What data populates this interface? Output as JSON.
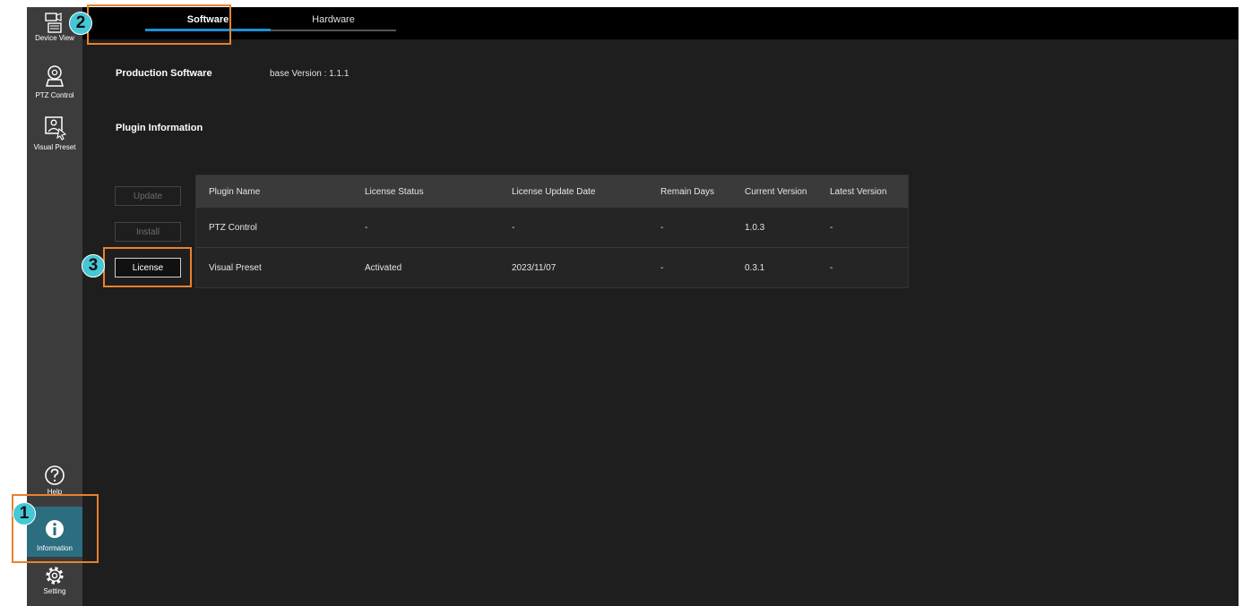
{
  "sidebar": {
    "top_items": [
      {
        "label": "Device View",
        "icon": "device-view-icon"
      },
      {
        "label": "PTZ Control",
        "icon": "ptz-camera-icon"
      },
      {
        "label": "Visual Preset",
        "icon": "visual-preset-icon"
      }
    ],
    "bottom_items": [
      {
        "label": "Help",
        "icon": "help-icon"
      },
      {
        "label": "Information",
        "icon": "info-icon",
        "active": true
      },
      {
        "label": "Setting",
        "icon": "gear-icon"
      }
    ]
  },
  "tabs": [
    {
      "label": "Software",
      "active": true
    },
    {
      "label": "Hardware",
      "active": false
    }
  ],
  "software": {
    "production_label": "Production Software",
    "production_version": "base Version : 1.1.1",
    "plugin_info_label": "Plugin Information"
  },
  "buttons": {
    "update": "Update",
    "install": "Install",
    "license": "License"
  },
  "table": {
    "headers": [
      "Plugin Name",
      "License Status",
      "License Update Date",
      "Remain Days",
      "Current Version",
      "Latest Version"
    ],
    "rows": [
      [
        "PTZ Control",
        "-",
        "-",
        "-",
        "1.0.3",
        "-"
      ],
      [
        "Visual Preset",
        "Activated",
        "2023/11/07",
        "-",
        "0.3.1",
        "-"
      ]
    ]
  },
  "annotations": [
    "1",
    "2",
    "3"
  ],
  "colors": {
    "accent": "#1c8fd6",
    "active_sidebar": "#2c6e80",
    "annotation_orange": "#e8822c",
    "badge_cyan": "#45c7d6"
  }
}
